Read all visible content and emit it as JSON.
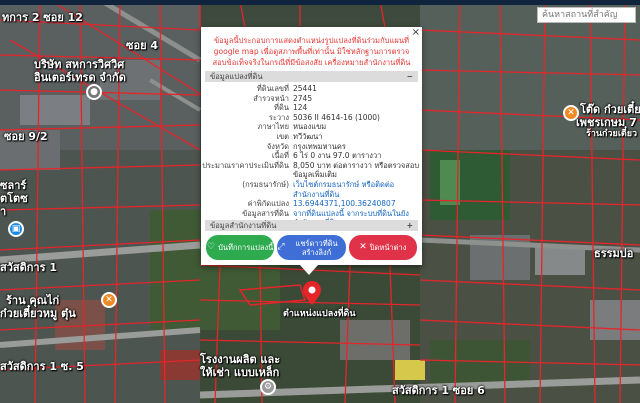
{
  "search": {
    "placeholder": "ค้นหาสถานที่สำคัญ"
  },
  "map_labels": {
    "soi12": "ทการ 2 ซอย 12",
    "soi4": "ซอย 4",
    "company1": "บริษัท สหการวิศวิศ",
    "company2": "อินเตอร์เทรด จำกัด",
    "soi92": "ซอย 9/2",
    "solar1": "ซลาร์",
    "solar2": "ตโตซ",
    "solar3": "า",
    "sawasdikarn1": "สวัสดิการ 1",
    "kuaytiew1": "ร้าน คุณไก่",
    "kuaytiew2": "ก๋วยเตี๋ยวหมู ตุ๋น",
    "sawasdikarn1soi5": "สวัสดิการ 1 ซ. 5",
    "factory1": "โรงงานผลิต และ",
    "factory2": "ให้เช่า แบบเหล็ก",
    "sawasdikarn1soi6": "สวัสดิการ 1 ซอย 6",
    "shop1": "โต๊ด ก๋วยเตี๋ยว",
    "shop2": "เพชรเกษม 7",
    "shop3": "ร้านก๋วยเตี๋ยว",
    "bor": "ธรรมบ่อ",
    "parcel_pin_label": "ตำแหน่งแปลงที่ดิน"
  },
  "popup": {
    "warning": "ข้อมูลนี้ประกอบการแสดงตำแหน่งรูปแปลงที่ดินร่วมกับแผนที่ google map เพื่อดูสภาพพื้นที่เท่านั้น มิใช่หลักฐานการตรวจสอบข้อเท็จจริงในกรณีที่มีข้อสงสัย เครื่องหมายสำนักงานที่ดิน",
    "section_parcel": "ข้อมูลแปลงที่ดิน",
    "section_parcel_symbol": "−",
    "rows": [
      {
        "k": "ที่ดินเลขที่",
        "v": "25441"
      },
      {
        "k": "สำรวจหน้า",
        "v": "2745"
      },
      {
        "k": "ที่ดิน",
        "v": "124"
      },
      {
        "k": "ระวาง",
        "v": "5036 II 4614-16 (1000)"
      },
      {
        "k": "ภาษาไทย",
        "v": "หนองแขม"
      },
      {
        "k": "เขต",
        "v": "ทวีวัฒนา"
      },
      {
        "k": "จังหวัด",
        "v": "กรุงเทพมหานคร"
      },
      {
        "k": "เนื้อที่",
        "v": "6 ไร่ 0 งาน 97.0 ตารางวา"
      },
      {
        "k": "ประมาณราคาประเมินที่ดิน",
        "v": "8,050 บาท ต่อตารางวา หรือตรวจสอบข้อมูลเพิ่มเติม"
      },
      {
        "k": "(กรมธนารักษ์)",
        "v": "เว็บไซต์กรมธนารักษ์ หรือติดต่อสำนักงานที่ดิน",
        "link": true
      },
      {
        "k": "ค่าพิกัดแปลง",
        "v": "13.6944371,100.36240807",
        "link": true
      },
      {
        "k": "ข้อมูลสารที่ดิน",
        "v": "จากที่ดินแปลงนี้ จากระบบที่ดินในยังสำนักงานที่ดิน",
        "link": true
      }
    ],
    "section_office": "ข้อมูลสำนักงานที่ดิน",
    "section_office_symbol": "+",
    "buttons": {
      "save": "บันทึกการแปลงนี้",
      "share": "แชร์ดาวที่ดิน สร้างลิงก์",
      "close": "ปิดหน้าต่าง"
    },
    "close_symbol": "×"
  },
  "colors": {
    "green": "#2eaa4f",
    "blue": "#3f6fd6",
    "red": "#e0334a",
    "parcel_lines": "#e5252a",
    "warning_text": "#e53935"
  }
}
